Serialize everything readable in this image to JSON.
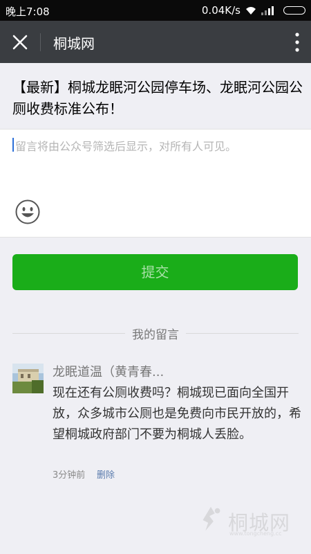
{
  "status_bar": {
    "time": "晚上7:08",
    "network_speed": "0.04K/s"
  },
  "title_bar": {
    "title": "桐城网"
  },
  "article": {
    "headline": "【最新】桐城龙眠河公园停车场、龙眠河公园公厕收费标准公布！"
  },
  "comment_input": {
    "placeholder": "留言将由公众号筛选后显示，对所有人可见。"
  },
  "submit": {
    "label": "提交"
  },
  "my_comments": {
    "heading": "我的留言",
    "items": [
      {
        "author": "龙眠道温（黄青春...",
        "text": "现在还有公厕收费吗？桐城现已面向全国开放，众多城市公厕也是免费向市民开放的，希望桐城政府部门不要为桐城人丢脸。",
        "time": "3分钟前",
        "delete_label": "删除"
      }
    ]
  },
  "watermark": {
    "text": "桐城网",
    "url": "www.tongcheng.cc"
  },
  "colors": {
    "accent_green": "#1aad19",
    "title_bar": "#3a3d41",
    "link_blue": "#5b7cad"
  }
}
